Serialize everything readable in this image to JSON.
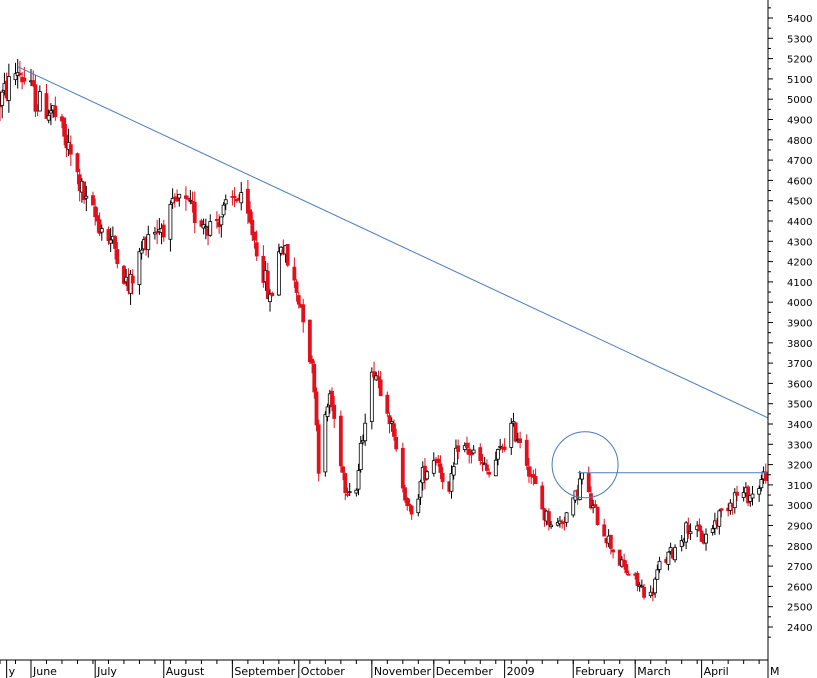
{
  "chart_data": {
    "type": "candlestick",
    "title": "",
    "xlabel": "",
    "ylabel": "",
    "ylim": [
      2300,
      5480
    ],
    "y_ticks": [
      2400,
      2500,
      2600,
      2700,
      2800,
      2900,
      3000,
      3100,
      3200,
      3300,
      3400,
      3500,
      3600,
      3700,
      3800,
      3900,
      4000,
      4100,
      4200,
      4300,
      4400,
      4500,
      4600,
      4700,
      4800,
      4900,
      5000,
      5100,
      5200,
      5300,
      5400
    ],
    "y_tick_labels": [
      "2400",
      "2500",
      "2600",
      "2700",
      "2800",
      "2900",
      "3000",
      "3100",
      "3200",
      "3300",
      "3400",
      "3500",
      "3600",
      "3700",
      "3800",
      "3900",
      "4000",
      "4100",
      "4200",
      "4300",
      "4400",
      "4500",
      "4600",
      "4700",
      "4800",
      "4900",
      "5000",
      "5100",
      "5200",
      "5300",
      "5400"
    ],
    "x_labels": [
      "y",
      "June",
      "July",
      "August",
      "September",
      "October",
      "November",
      "December",
      "2009",
      "February",
      "March",
      "April",
      "M"
    ],
    "x_label_date": [
      "2008-05-22",
      "2008-06-02",
      "2008-07-01",
      "2008-08-01",
      "2008-09-01",
      "2008-10-01",
      "2008-11-03",
      "2008-12-01",
      "2009-01-02",
      "2009-02-02",
      "2009-03-02",
      "2009-04-01",
      "2009-05-01"
    ],
    "x_range_dates": [
      "2008-05-19",
      "2009-05-01"
    ],
    "colors": {
      "up": "#ffffff",
      "down": "#e0101c",
      "trendline": "#4a7bc0",
      "grid": "#000000"
    },
    "trendline": {
      "from": {
        "date": "2008-05-27",
        "value": 5160
      },
      "to": {
        "date": "2009-05-01",
        "value": 3430
      }
    },
    "horizontal_line": {
      "from_date": "2009-02-04",
      "to_date": "2009-05-01",
      "value": 3160
    },
    "circle_annotation": {
      "date": "2009-02-06",
      "value": 3130
    },
    "trend_path": [
      [
        "2008-05-19",
        4990
      ],
      [
        "2008-05-27",
        5150
      ],
      [
        "2008-06-05",
        4980
      ],
      [
        "2008-06-12",
        4940
      ],
      [
        "2008-06-20",
        4720
      ],
      [
        "2008-06-27",
        4480
      ],
      [
        "2008-07-04",
        4370
      ],
      [
        "2008-07-11",
        4250
      ],
      [
        "2008-07-16",
        4060
      ],
      [
        "2008-07-25",
        4350
      ],
      [
        "2008-08-01",
        4380
      ],
      [
        "2008-08-08",
        4500
      ],
      [
        "2008-08-15",
        4430
      ],
      [
        "2008-08-22",
        4380
      ],
      [
        "2008-08-29",
        4450
      ],
      [
        "2008-09-03",
        4530
      ],
      [
        "2008-09-10",
        4350
      ],
      [
        "2008-09-15",
        4150
      ],
      [
        "2008-09-18",
        4000
      ],
      [
        "2008-09-23",
        4300
      ],
      [
        "2008-09-30",
        4050
      ],
      [
        "2008-10-03",
        3950
      ],
      [
        "2008-10-08",
        3600
      ],
      [
        "2008-10-10",
        3200
      ],
      [
        "2008-10-15",
        3550
      ],
      [
        "2008-10-22",
        3100
      ],
      [
        "2008-10-27",
        3080
      ],
      [
        "2008-10-31",
        3450
      ],
      [
        "2008-11-04",
        3680
      ],
      [
        "2008-11-10",
        3500
      ],
      [
        "2008-11-14",
        3250
      ],
      [
        "2008-11-21",
        2930
      ],
      [
        "2008-11-26",
        3150
      ],
      [
        "2008-12-02",
        3250
      ],
      [
        "2008-12-08",
        3050
      ],
      [
        "2008-12-12",
        3300
      ],
      [
        "2008-12-19",
        3250
      ],
      [
        "2008-12-26",
        3150
      ],
      [
        "2009-01-05",
        3380
      ],
      [
        "2009-01-09",
        3330
      ],
      [
        "2009-01-14",
        3150
      ],
      [
        "2009-01-20",
        2950
      ],
      [
        "2009-01-26",
        2900
      ],
      [
        "2009-02-02",
        3000
      ],
      [
        "2009-02-06",
        3150
      ],
      [
        "2009-02-10",
        3000
      ],
      [
        "2009-02-17",
        2850
      ],
      [
        "2009-02-24",
        2700
      ],
      [
        "2009-03-04",
        2600
      ],
      [
        "2009-03-09",
        2550
      ],
      [
        "2009-03-13",
        2700
      ],
      [
        "2009-03-19",
        2770
      ],
      [
        "2009-03-26",
        2900
      ],
      [
        "2009-04-02",
        2830
      ],
      [
        "2009-04-09",
        2950
      ],
      [
        "2009-04-16",
        3050
      ],
      [
        "2009-04-24",
        3050
      ],
      [
        "2009-04-30",
        3160
      ]
    ]
  }
}
